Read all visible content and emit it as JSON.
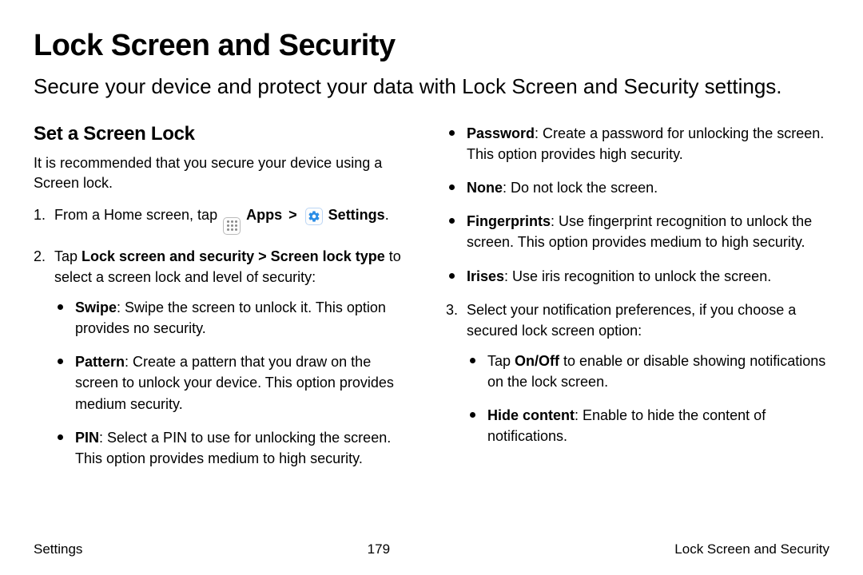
{
  "title": "Lock Screen and Security",
  "intro": "Secure your device and protect your data with Lock Screen and Security settings.",
  "section_heading": "Set a Screen Lock",
  "recommendation": "It is recommended that you secure your device using a Screen lock.",
  "step1": {
    "num": "1.",
    "pre": "From a Home screen, tap",
    "apps_label": "Apps",
    "settings_label": "Settings",
    "end": "."
  },
  "step2": {
    "num": "2.",
    "pre": "Tap ",
    "bold": "Lock screen and security > Screen lock type",
    "post": " to select a screen lock and level of security:",
    "options": [
      {
        "label": "Swipe",
        "desc": ": Swipe the screen to unlock it. This option provides no security."
      },
      {
        "label": "Pattern",
        "desc": ": Create a pattern that you draw on the screen to unlock your device. This option provides medium security."
      },
      {
        "label": "PIN",
        "desc": ": Select a PIN to use for unlocking the screen. This option provides medium to high security."
      }
    ]
  },
  "right_options": [
    {
      "label": "Password",
      "desc": ": Create a password for unlocking the screen. This option provides high security."
    },
    {
      "label": "None",
      "desc": ": Do not lock the screen."
    },
    {
      "label": "Fingerprints",
      "desc": ": Use fingerprint recognition to unlock the screen. This option provides medium to high security."
    },
    {
      "label": "Irises",
      "desc": ": Use iris recognition to unlock the screen."
    }
  ],
  "step3": {
    "num": "3.",
    "text": "Select your notification preferences, if you choose a secured lock screen option:",
    "subs": [
      {
        "pre": "Tap ",
        "bold": "On/Off",
        "post": " to enable or disable showing notifications on the lock screen."
      },
      {
        "pre": "",
        "bold": "Hide content",
        "post": ": Enable to hide the content of notifications."
      }
    ]
  },
  "footer": {
    "left": "Settings",
    "center": "179",
    "right": "Lock Screen and Security"
  }
}
